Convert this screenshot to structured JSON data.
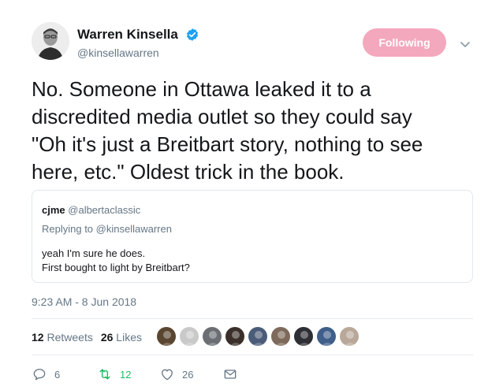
{
  "author": {
    "name": "Warren Kinsella",
    "handle": "@kinsellawarren",
    "verified": true
  },
  "follow_button": {
    "label": "Following",
    "color": "#f4a8bd"
  },
  "tweet": {
    "text": "No.  Someone in Ottawa leaked it to a\ndiscredited media outlet so they could say\n\"Oh it's just a Breitbart story, nothing to see\nhere, etc.\"  Oldest trick in the book."
  },
  "quoted_tweet": {
    "name": "cjme",
    "handle": "@albertaclassic",
    "replying_to": "Replying to @kinsellawarren",
    "text": "yeah I'm sure he does.\nFirst bought to light by Breitbart?"
  },
  "timestamp": "9:23 AM - 8 Jun 2018",
  "stats": {
    "retweets_count": "12",
    "retweets_label": "Retweets",
    "likes_count": "26",
    "likes_label": "Likes"
  },
  "liker_avatars": [
    {
      "color": "#5a4630"
    },
    {
      "color": "#c9c9c9"
    },
    {
      "color": "#6b6f73"
    },
    {
      "color": "#3a2f2a"
    },
    {
      "color": "#4a5c78"
    },
    {
      "color": "#7d6a5a"
    },
    {
      "color": "#2e2e35"
    },
    {
      "color": "#3f5f8a"
    },
    {
      "color": "#b9a89a"
    }
  ],
  "actions": {
    "reply_count": "6",
    "retweet_count": "12",
    "like_count": "26"
  },
  "icons": {
    "verified": "verified-badge-icon",
    "caret": "chevron-down-icon",
    "reply": "reply-icon",
    "retweet": "retweet-icon",
    "like": "heart-icon",
    "dm": "envelope-icon"
  },
  "colors": {
    "text": "#14171a",
    "secondary": "#657786",
    "verified": "#1da1f2",
    "retweet_green": "#17bf63",
    "border": "#e1e8ed"
  }
}
